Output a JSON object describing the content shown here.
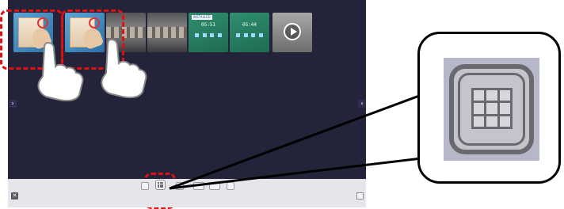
{
  "thumbnails": [
    {
      "kind": "app"
    },
    {
      "kind": "app"
    },
    {
      "kind": "building"
    },
    {
      "kind": "building"
    },
    {
      "kind": "green",
      "clock": "05:51",
      "badge": "INSTALLED"
    },
    {
      "kind": "green",
      "clock": "05:44"
    },
    {
      "kind": "video"
    }
  ],
  "icons": {
    "nav_left": "chevron-right-icon",
    "nav_right": "chevron-left-icon",
    "close": "close-icon",
    "grid": "grid-icon"
  },
  "colors": {
    "screen_bg": "#23233a",
    "highlight": "#e01010",
    "toolbar_bg": "#e6e6ea"
  },
  "nav": {
    "left_glyph": "›",
    "right_glyph": "‹"
  },
  "bottom": {
    "close_glyph": "✕"
  }
}
